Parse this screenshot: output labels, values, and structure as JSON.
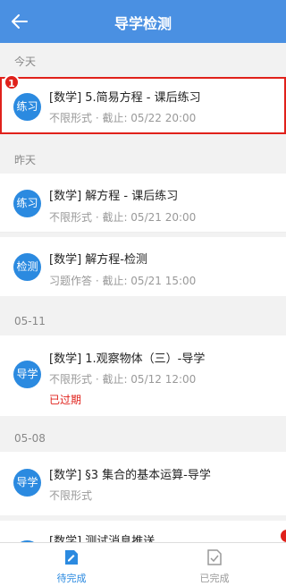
{
  "header": {
    "title": "导学检测"
  },
  "sections": {
    "today": "今天",
    "yesterday": "昨天",
    "d0511": "05-11",
    "d0508": "05-08"
  },
  "tasks": [
    {
      "badge": "练习",
      "title": "[数学] 5.简易方程 - 课后练习",
      "meta": "不限形式 · 截止: 05/22 20:00"
    },
    {
      "badge": "练习",
      "title": "[数学] 解方程 - 课后练习",
      "meta": "不限形式 · 截止: 05/21 20:00"
    },
    {
      "badge": "检测",
      "title": "[数学] 解方程-检测",
      "meta": "习题作答 · 截止: 05/21 15:00"
    },
    {
      "badge": "导学",
      "title": "[数学] 1.观察物体（三）-导学",
      "meta": "不限形式 · 截止: 05/12 12:00",
      "status": "已过期"
    },
    {
      "badge": "导学",
      "title": "[数学] §3 集合的基本运算-导学",
      "meta": "不限形式"
    },
    {
      "badge": "",
      "title": "[数学] 测试消息推送",
      "meta": ""
    }
  ],
  "annotation": {
    "number": "1"
  },
  "colors": {
    "header": "#4a90e2",
    "badge": "#2b8ae0",
    "highlight": "#e0211b",
    "active_tab": "#2b8ae0",
    "inactive_tab": "#999999"
  },
  "nav": {
    "pending": {
      "label": "待完成",
      "icon": "edit-doc-icon"
    },
    "done": {
      "label": "已完成",
      "icon": "checked-doc-icon"
    }
  }
}
